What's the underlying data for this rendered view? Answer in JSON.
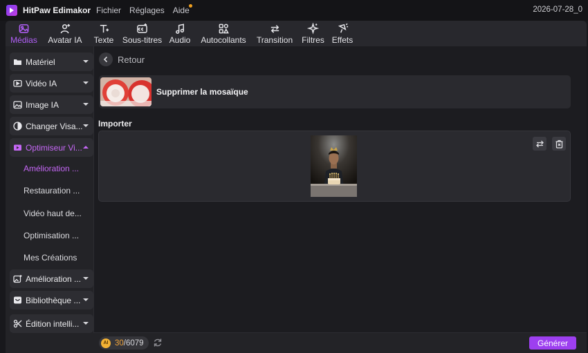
{
  "app": {
    "name": "HitPaw Edimakor",
    "menu": [
      "Fichier",
      "Réglages",
      "Aide"
    ],
    "date": "2026-07-28_0"
  },
  "tabs": [
    {
      "label": "Médias",
      "icon": "media-icon",
      "active": true
    },
    {
      "label": "Avatar IA",
      "icon": "avatar-icon",
      "active": false
    },
    {
      "label": "Texte",
      "icon": "text-icon",
      "active": false
    },
    {
      "label": "Sous-titres",
      "icon": "subtitles-icon",
      "active": false
    },
    {
      "label": "Audio",
      "icon": "audio-icon",
      "active": false
    },
    {
      "label": "Autocollants",
      "icon": "stickers-icon",
      "active": false
    },
    {
      "label": "Transition",
      "icon": "transition-icon",
      "active": false
    },
    {
      "label": "Filtres",
      "icon": "filters-icon",
      "active": false
    },
    {
      "label": "Effets",
      "icon": "effects-icon",
      "active": false
    }
  ],
  "sidebar": {
    "groups": [
      {
        "label": "Matériel",
        "icon": "folder-icon"
      },
      {
        "label": "Vidéo IA",
        "icon": "video-ai-icon"
      },
      {
        "label": "Image IA",
        "icon": "image-ai-icon"
      },
      {
        "label": "Changer Visa...",
        "icon": "face-swap-icon"
      },
      {
        "label": "Optimiseur Vi...",
        "icon": "optimizer-icon",
        "open": true
      },
      {
        "label": "Amélioration ...",
        "icon": "enhance-icon"
      },
      {
        "label": "Bibliothèque ...",
        "icon": "library-icon"
      },
      {
        "label": "Édition intelli...",
        "icon": "smart-edit-icon"
      }
    ],
    "sub_items": [
      {
        "label": "Amélioration ...",
        "active": true
      },
      {
        "label": "Restauration ...",
        "active": false
      },
      {
        "label": "Vidéo haut de...",
        "active": false
      },
      {
        "label": "Optimisation ...",
        "active": false
      },
      {
        "label": "Mes Créations",
        "active": false
      }
    ]
  },
  "main": {
    "back_label": "Retour",
    "feature_title": "Supprimer la mosaïque",
    "import_label": "Importer"
  },
  "bottom": {
    "credits_used": "30",
    "credits_total": "/6079",
    "coin_label": "AI",
    "generate_label": "Générer"
  },
  "colors": {
    "accent": "#b15ff7",
    "generate": "#9d3ff0",
    "credits": "#f0a53c"
  }
}
